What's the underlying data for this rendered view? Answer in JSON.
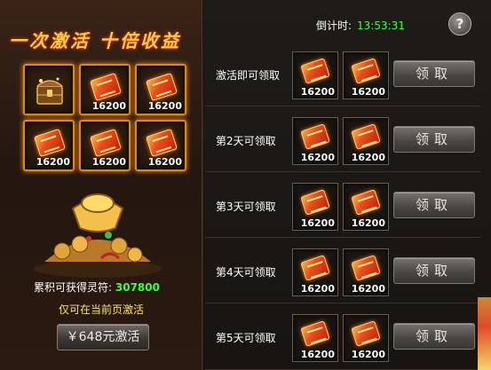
{
  "left": {
    "title": "一次激活 十倍收益",
    "grid_items": [
      {
        "icon": "treasure-chest-icon",
        "count": ""
      },
      {
        "icon": "talisman-icon",
        "count": "16200"
      },
      {
        "icon": "talisman-icon",
        "count": "16200"
      },
      {
        "icon": "talisman-icon",
        "count": "16200"
      },
      {
        "icon": "talisman-icon",
        "count": "16200"
      },
      {
        "icon": "talisman-icon",
        "count": "16200"
      }
    ],
    "total_label": "累积可获得灵符:",
    "total_value": "307800",
    "notice": "仅可在当前页激活",
    "buy_button": "￥648元激活"
  },
  "right": {
    "countdown_label": "倒计时:",
    "countdown_value": "13:53:31",
    "help_label": "?",
    "rows": [
      {
        "label": "激活即可领取",
        "items": [
          "16200",
          "16200"
        ],
        "button": "领取"
      },
      {
        "label": "第2天可领取",
        "items": [
          "16200",
          "16200"
        ],
        "button": "领取"
      },
      {
        "label": "第3天可领取",
        "items": [
          "16200",
          "16200"
        ],
        "button": "领取"
      },
      {
        "label": "第4天可领取",
        "items": [
          "16200",
          "16200"
        ],
        "button": "领取"
      },
      {
        "label": "第5天可领取",
        "items": [
          "16200",
          "16200"
        ],
        "button": "领取"
      }
    ]
  },
  "colors": {
    "accent_gold": "#ffcf4a",
    "highlight_green": "#3cff3c",
    "notice_yellow": "#ffe34a",
    "slot_glow": "#d98a1e"
  }
}
